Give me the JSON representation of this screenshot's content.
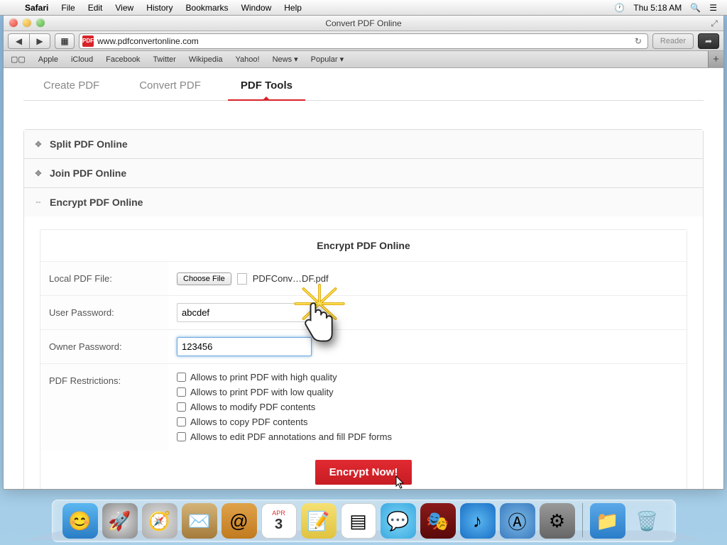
{
  "menubar": {
    "app": "Safari",
    "items": [
      "File",
      "Edit",
      "View",
      "History",
      "Bookmarks",
      "Window",
      "Help"
    ],
    "clock": "Thu 5:18 AM"
  },
  "window": {
    "title": "Convert PDF Online",
    "url": "www.pdfconvertonline.com",
    "favicon": "PDF",
    "reader": "Reader"
  },
  "bookmarks": [
    "Apple",
    "iCloud",
    "Facebook",
    "Twitter",
    "Wikipedia",
    "Yahoo!",
    "News",
    "Popular"
  ],
  "tabs": {
    "items": [
      "Create PDF",
      "Convert PDF",
      "PDF Tools"
    ],
    "active": 2
  },
  "accordion": {
    "split": "Split PDF Online",
    "join": "Join PDF Online",
    "encrypt": "Encrypt PDF Online"
  },
  "form": {
    "title": "Encrypt PDF Online",
    "labels": {
      "file": "Local PDF File:",
      "userpw": "User Password:",
      "ownerpw": "Owner Password:",
      "restrict": "PDF Restrictions:"
    },
    "choose": "Choose File",
    "filename": "PDFConv…DF.pdf",
    "userpw_value": "abcdef",
    "ownerpw_value": "123456",
    "restrictions": [
      "Allows to print PDF with high quality",
      "Allows to print PDF with low quality",
      "Allows to modify PDF contents",
      "Allows to copy PDF contents",
      "Allows to edit PDF annotations and fill PDF forms"
    ],
    "submit": "Encrypt Now!"
  },
  "dock": [
    "Finder",
    "Launchpad",
    "Safari",
    "Mail",
    "Contacts",
    "Calendar",
    "Notes",
    "Reminders",
    "Messages",
    "Photo Booth",
    "iTunes",
    "App Store",
    "System Preferences",
    "Downloads",
    "Trash"
  ]
}
